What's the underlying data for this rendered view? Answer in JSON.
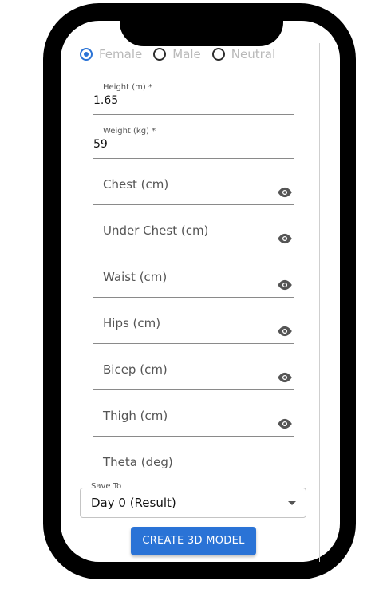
{
  "gender": {
    "options": [
      {
        "label": "Female",
        "selected": true
      },
      {
        "label": "Male",
        "selected": false
      },
      {
        "label": "Neutral",
        "selected": false
      }
    ]
  },
  "fields": {
    "height": {
      "label": "Height (m) *",
      "value": "1.65"
    },
    "weight": {
      "label": "Weight (kg) *",
      "value": "59"
    },
    "chest": {
      "placeholder": "Chest (cm)",
      "icon": "eye-icon"
    },
    "under_chest": {
      "placeholder": "Under Chest (cm)",
      "icon": "eye-icon"
    },
    "waist": {
      "placeholder": "Waist (cm)",
      "icon": "eye-icon"
    },
    "hips": {
      "placeholder": "Hips (cm)",
      "icon": "eye-icon"
    },
    "bicep": {
      "placeholder": "Bicep (cm)",
      "icon": "eye-icon"
    },
    "thigh": {
      "placeholder": "Thigh (cm)",
      "icon": "eye-icon"
    },
    "theta": {
      "placeholder": "Theta (deg)"
    }
  },
  "save_to": {
    "label": "Save To",
    "value": "Day 0 (Result)"
  },
  "button": {
    "label": "CREATE 3D MODEL"
  },
  "colors": {
    "accent": "#2a73d6",
    "device": "#000000"
  }
}
